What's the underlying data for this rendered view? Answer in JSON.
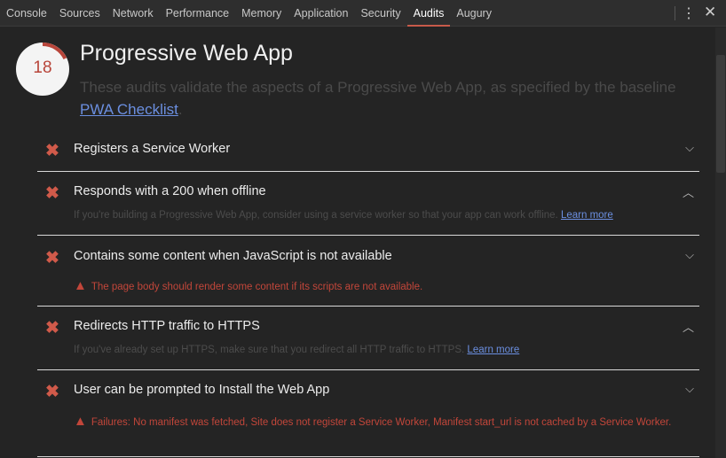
{
  "tabs": [
    "Console",
    "Sources",
    "Network",
    "Performance",
    "Memory",
    "Application",
    "Security",
    "Audits",
    "Augury"
  ],
  "active_tab": "Audits",
  "score": "18",
  "score_fraction": 0.18,
  "heading": "Progressive Web App",
  "description": "These audits validate the aspects of a Progressive Web App, as specified by the baseline",
  "checklist_link": "PWA Checklist",
  "period": ".",
  "audits": [
    {
      "title": "Registers a Service Worker"
    },
    {
      "title": "Responds with a 200 when offline",
      "help": "If you're building a Progressive Web App, consider using a service worker so that your app can work offline.",
      "link": "Learn more"
    },
    {
      "title": "Contains some content when JavaScript is not available",
      "warning": "The page body should render some content if its scripts are not available."
    },
    {
      "title": "Redirects HTTP traffic to HTTPS",
      "help": "If you've already set up HTTPS, make sure that you redirect all HTTP traffic to HTTPS.",
      "link": "Learn more"
    },
    {
      "title": "User can be prompted to Install the Web App",
      "warning": "Failures: No manifest was fetched, Site does not register a Service Worker, Manifest start_url is not cached by a Service Worker."
    }
  ]
}
